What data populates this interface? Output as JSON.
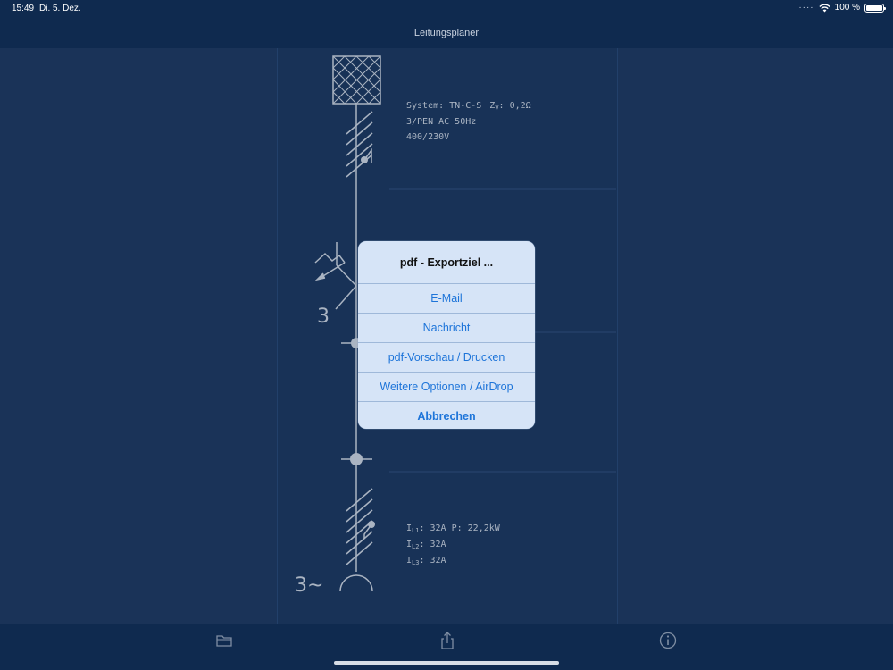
{
  "status_bar": {
    "time": "15:49",
    "date": "Di. 5. Dez.",
    "battery": "100 %"
  },
  "nav": {
    "title": "Leitungsplaner"
  },
  "diagram": {
    "system_line1": "System: TN-C-S",
    "zv_label": "Z",
    "zv_sub": "V",
    "zv_value": ": 0,2Ω",
    "system_line2": "3/PEN AC 50Hz",
    "system_line3": "400/230V",
    "breaker_poles": "3",
    "load_l1_prefix": "I",
    "load_l1_sub": "L1",
    "load_l1_value": ": 32A  P: 22,2kW",
    "load_l2_prefix": "I",
    "load_l2_sub": "L2",
    "load_l2_value": ": 32A",
    "load_l3_prefix": "I",
    "load_l3_sub": "L3",
    "load_l3_value": ": 32A",
    "motor_label": "3~"
  },
  "dialog": {
    "title": "pdf - Exportziel ...",
    "options": [
      "E-Mail",
      "Nachricht",
      "pdf-Vorschau / Drucken",
      "Weitere Optionen / AirDrop"
    ],
    "cancel": "Abbrechen"
  },
  "toolbar": {
    "icons": [
      "folder-icon",
      "share-icon",
      "info-icon"
    ]
  },
  "colors": {
    "accent": "#1d74d9",
    "bar": "#0f2a4f",
    "background": "#1a3358",
    "line": "#aab4c2"
  }
}
